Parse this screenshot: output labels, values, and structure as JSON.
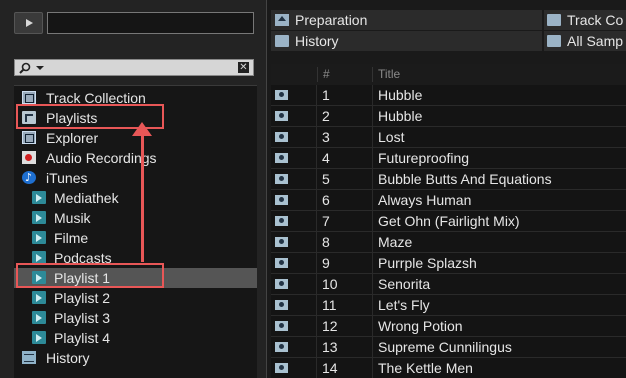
{
  "browser": {
    "tree": {
      "items": [
        {
          "label": "Track Collection",
          "icon": "track-collection-icon"
        },
        {
          "label": "Playlists",
          "icon": "playlists-icon"
        },
        {
          "label": "Explorer",
          "icon": "explorer-icon"
        },
        {
          "label": "Audio Recordings",
          "icon": "audio-recordings-icon"
        },
        {
          "label": "iTunes",
          "icon": "itunes-icon"
        },
        {
          "label": "Mediathek",
          "icon": "playlist-icon"
        },
        {
          "label": "Musik",
          "icon": "playlist-icon"
        },
        {
          "label": "Filme",
          "icon": "playlist-icon"
        },
        {
          "label": "Podcasts",
          "icon": "playlist-icon"
        },
        {
          "label": "Playlist 1",
          "icon": "playlist-icon",
          "selected": true
        },
        {
          "label": "Playlist 2",
          "icon": "playlist-icon"
        },
        {
          "label": "Playlist 3",
          "icon": "playlist-icon"
        },
        {
          "label": "Playlist 4",
          "icon": "playlist-icon"
        },
        {
          "label": "History",
          "icon": "history-icon"
        }
      ]
    },
    "favorites": [
      {
        "label": "Preparation",
        "icon": "home-icon"
      },
      {
        "label": "Track Co",
        "icon": "folder-icon"
      },
      {
        "label": "History",
        "icon": "folder-icon"
      },
      {
        "label": "All Samp",
        "icon": "folder-icon"
      }
    ],
    "columns": {
      "number": "#",
      "title": "Title"
    },
    "tracks": [
      {
        "n": "1",
        "title": "Hubble"
      },
      {
        "n": "2",
        "title": "Hubble"
      },
      {
        "n": "3",
        "title": "Lost"
      },
      {
        "n": "4",
        "title": "Futureproofing"
      },
      {
        "n": "5",
        "title": "Bubble Butts And Equations"
      },
      {
        "n": "6",
        "title": "Always Human"
      },
      {
        "n": "7",
        "title": "Get Ohn (Fairlight Mix)"
      },
      {
        "n": "8",
        "title": "Maze"
      },
      {
        "n": "9",
        "title": "Purrple Splazsh"
      },
      {
        "n": "10",
        "title": "Senorita"
      },
      {
        "n": "11",
        "title": "Let's Fly"
      },
      {
        "n": "12",
        "title": "Wrong Potion"
      },
      {
        "n": "13",
        "title": "Supreme Cunnilingus"
      },
      {
        "n": "14",
        "title": "The Kettle Men"
      }
    ]
  },
  "annotation": {
    "color": "#e85757"
  }
}
